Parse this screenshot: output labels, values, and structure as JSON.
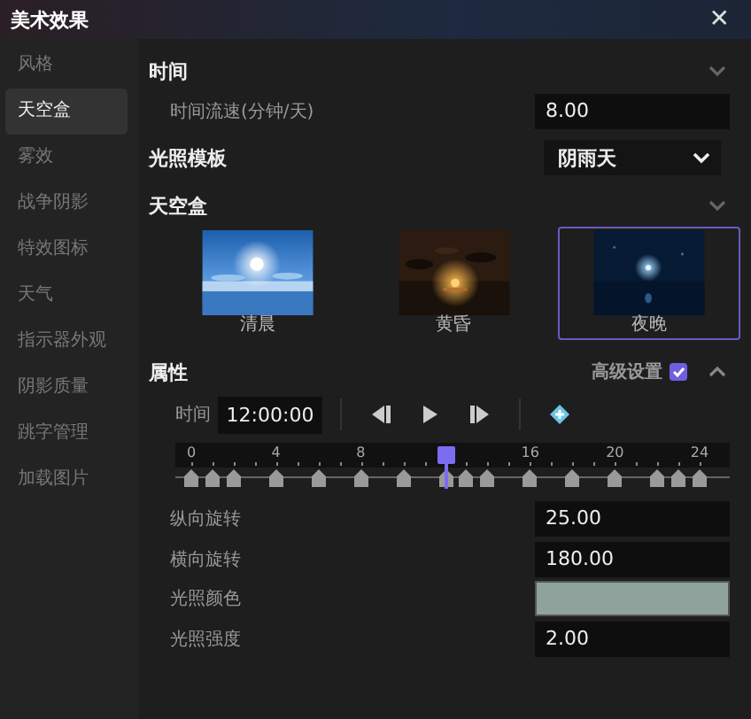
{
  "window": {
    "title": "美术效果",
    "close": "✕"
  },
  "sidebar": {
    "items": [
      {
        "label": "风格",
        "selected": false
      },
      {
        "label": "天空盒",
        "selected": true
      },
      {
        "label": "雾效",
        "selected": false
      },
      {
        "label": "战争阴影",
        "selected": false
      },
      {
        "label": "特效图标",
        "selected": false
      },
      {
        "label": "天气",
        "selected": false
      },
      {
        "label": "指示器外观",
        "selected": false
      },
      {
        "label": "阴影质量",
        "selected": false
      },
      {
        "label": "跳字管理",
        "selected": false
      },
      {
        "label": "加载图片",
        "selected": false
      }
    ]
  },
  "time_section": {
    "title": "时间",
    "expanded": false,
    "flow_label": "时间流速(分钟/天)",
    "flow_value": "8.00"
  },
  "lighting_template": {
    "label": "光照模板",
    "value": "阴雨天"
  },
  "skybox_section": {
    "title": "天空盒",
    "expanded": false,
    "skyboxes": [
      {
        "kind": "day",
        "label": "清晨",
        "selected": false
      },
      {
        "kind": "dusk",
        "label": "黄昏",
        "selected": false
      },
      {
        "kind": "night",
        "label": "夜晚",
        "selected": true
      }
    ]
  },
  "properties_section": {
    "title": "属性",
    "expanded": true,
    "advanced_label": "高级设置",
    "advanced_checked": true,
    "time_label": "时间",
    "time_value": "12:00:00",
    "timeline": {
      "ticks": [
        "0",
        "4",
        "8",
        "16",
        "20",
        "24"
      ],
      "thumb": {
        "level": 0.5
      },
      "keyframes": [
        {
          "level": 0
        },
        {
          "level": 0.0417
        },
        {
          "level": 0.0833
        },
        {
          "level": 0.1667
        },
        {
          "level": 0.25
        },
        {
          "level": 0.3333
        },
        {
          "level": 0.4167
        },
        {
          "level": 0.5
        },
        {
          "level": 0.5417
        },
        {
          "level": 0.5833
        },
        {
          "level": 0.6667
        },
        {
          "level": 0.75
        },
        {
          "level": 0.8333
        },
        {
          "level": 0.9167
        },
        {
          "level": 0.9583
        },
        {
          "level": 1
        }
      ]
    },
    "rows": [
      {
        "kind": "number",
        "label": "纵向旋转",
        "value": "25.00"
      },
      {
        "kind": "number",
        "label": "横向旋转",
        "value": "180.00"
      },
      {
        "kind": "color",
        "label": "光照颜色",
        "color": "#8fa39c"
      },
      {
        "kind": "number",
        "label": "光照强度",
        "value": "2.00"
      }
    ]
  }
}
